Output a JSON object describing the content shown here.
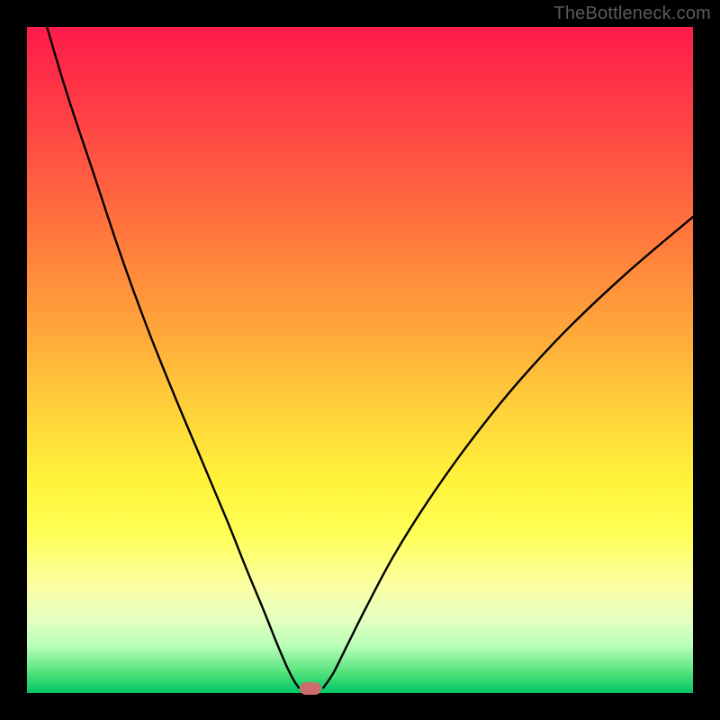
{
  "watermark": "TheBottleneck.com",
  "chart_data": {
    "type": "line",
    "title": "",
    "xlabel": "",
    "ylabel": "",
    "xlim": [
      0,
      100
    ],
    "ylim": [
      0,
      100
    ],
    "grid": false,
    "legend": false,
    "series": [
      {
        "name": "left-branch",
        "x": [
          3,
          6,
          10,
          14,
          18,
          22,
          26,
          30,
          33,
          35.5,
          37.5,
          39,
          40,
          40.8
        ],
        "y": [
          100,
          90,
          78,
          66,
          55,
          45,
          35.5,
          26,
          18.5,
          12.5,
          7.5,
          4,
          2,
          0.8
        ]
      },
      {
        "name": "right-branch",
        "x": [
          44.5,
          46,
          48,
          51,
          55,
          60,
          66,
          73,
          81,
          90,
          100
        ],
        "y": [
          0.8,
          3,
          7,
          13,
          20.5,
          28.5,
          37,
          45.8,
          54.5,
          63,
          71.5
        ]
      }
    ],
    "marker": {
      "name": "minimum-marker",
      "x": 42.5,
      "y": 0,
      "color": "#cc6d6d"
    },
    "gradient_stops": [
      {
        "pos": 0,
        "color": "#ff1b4a"
      },
      {
        "pos": 15,
        "color": "#ff4545"
      },
      {
        "pos": 32,
        "color": "#ff7a3c"
      },
      {
        "pos": 46,
        "color": "#ffa83a"
      },
      {
        "pos": 58,
        "color": "#ffd33a"
      },
      {
        "pos": 68,
        "color": "#fff23a"
      },
      {
        "pos": 76,
        "color": "#ffff55"
      },
      {
        "pos": 84,
        "color": "#fbffa4"
      },
      {
        "pos": 89,
        "color": "#e4ffc0"
      },
      {
        "pos": 93,
        "color": "#b8ffb8"
      },
      {
        "pos": 97,
        "color": "#50e27a"
      },
      {
        "pos": 100,
        "color": "#00c466"
      }
    ]
  }
}
